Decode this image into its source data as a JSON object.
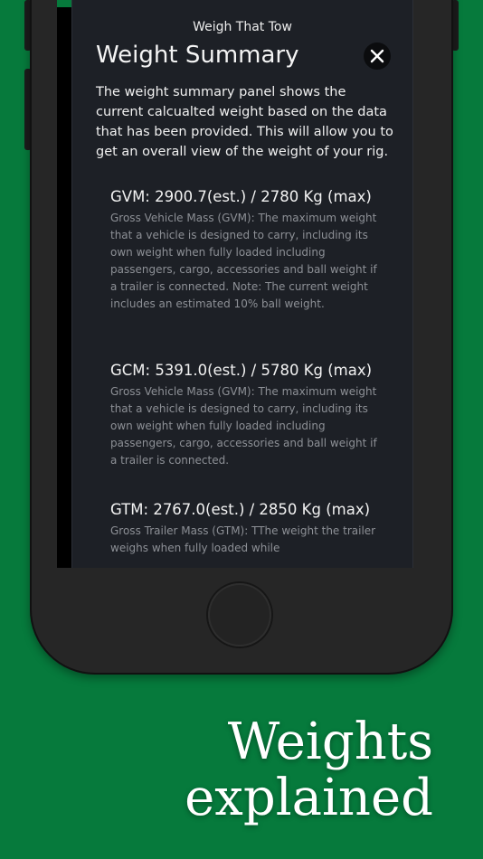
{
  "app": {
    "title": "Weigh That Tow"
  },
  "panel": {
    "title": "Weight Summary",
    "intro": "The weight summary panel shows the current calcualted weight based on the data that has been provided. This will allow you to get an overall view of the weight of your rig."
  },
  "sections": [
    {
      "heading": "GVM: 2900.7(est.) / 2780 Kg (max)",
      "description": "Gross Vehicle Mass (GVM): The maximum weight that a vehicle is designed to carry, including its own weight when fully loaded including passengers, cargo, accessories and ball weight if a trailer is connected.  Note: The current weight includes an estimated 10% ball weight."
    },
    {
      "heading": "GCM: 5391.0(est.) / 5780 Kg (max)",
      "description": "Gross Vehicle Mass (GVM): The maximum weight that a vehicle is designed to carry, including its own weight when fully loaded including passengers, cargo, accessories and ball weight if a trailer is connected."
    },
    {
      "heading": "GTM: 2767.0(est.) / 2850 Kg (max)",
      "description": "Gross Trailer Mass (GTM): TThe weight the trailer weighs when fully loaded while"
    }
  ],
  "caption": {
    "line1": "Weights",
    "line2": "explained"
  },
  "colors": {
    "background": "#067a3c",
    "panel": "#1d2026",
    "close_button": "#0b0c0e"
  },
  "icons": {
    "close": "close-icon"
  }
}
